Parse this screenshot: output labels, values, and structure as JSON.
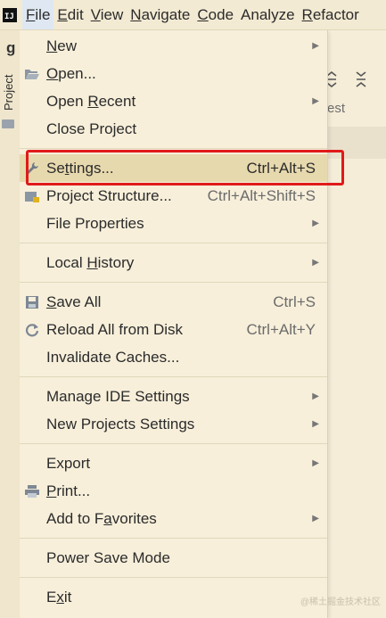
{
  "menubar": {
    "app_icon_text": "IJ",
    "menus": [
      {
        "label": "File",
        "mnemonic": "F",
        "rest": "ile"
      },
      {
        "label": "Edit",
        "mnemonic": "E",
        "rest": "dit"
      },
      {
        "label": "View",
        "mnemonic": "V",
        "rest": "iew"
      },
      {
        "label": "Navigate",
        "mnemonic": "N",
        "rest": "avigate"
      },
      {
        "label": "Code",
        "mnemonic": "C",
        "rest": "ode"
      },
      {
        "label": "Analyze",
        "mnemonic": "",
        "rest": "Analyze"
      },
      {
        "label": "Refactor",
        "mnemonic": "R",
        "rest": "efactor"
      }
    ]
  },
  "background": {
    "project_letter": "g",
    "project_tab": "Project",
    "right_text": "est"
  },
  "file_menu": {
    "items": [
      {
        "label_pre": "",
        "mn": "N",
        "label_post": "ew",
        "shortcut": "",
        "submenu": true,
        "icon": ""
      },
      {
        "label_pre": "",
        "mn": "O",
        "label_post": "pen...",
        "shortcut": "",
        "submenu": false,
        "icon": "folder-open-icon"
      },
      {
        "label_pre": "Open ",
        "mn": "R",
        "label_post": "ecent",
        "shortcut": "",
        "submenu": true,
        "icon": ""
      },
      {
        "label_pre": "Close Project",
        "mn": "",
        "label_post": "",
        "shortcut": "",
        "submenu": false,
        "icon": ""
      },
      {
        "label_pre": "Se",
        "mn": "t",
        "label_post": "tings...",
        "shortcut": "Ctrl+Alt+S",
        "submenu": false,
        "icon": "wrench-icon"
      },
      {
        "label_pre": "Project Structure...",
        "mn": "",
        "label_post": "",
        "shortcut": "Ctrl+Alt+Shift+S",
        "submenu": false,
        "icon": "project-structure-icon"
      },
      {
        "label_pre": "File Properties",
        "mn": "",
        "label_post": "",
        "shortcut": "",
        "submenu": true,
        "icon": ""
      },
      {
        "label_pre": "Local ",
        "mn": "H",
        "label_post": "istory",
        "shortcut": "",
        "submenu": true,
        "icon": ""
      },
      {
        "label_pre": "",
        "mn": "S",
        "label_post": "ave All",
        "shortcut": "Ctrl+S",
        "submenu": false,
        "icon": "save-icon"
      },
      {
        "label_pre": "Reload All from Disk",
        "mn": "",
        "label_post": "",
        "shortcut": "Ctrl+Alt+Y",
        "submenu": false,
        "icon": "reload-icon"
      },
      {
        "label_pre": "Invalidate Caches...",
        "mn": "",
        "label_post": "",
        "shortcut": "",
        "submenu": false,
        "icon": ""
      },
      {
        "label_pre": "Manage IDE Settings",
        "mn": "",
        "label_post": "",
        "shortcut": "",
        "submenu": true,
        "icon": ""
      },
      {
        "label_pre": "New Projects Settings",
        "mn": "",
        "label_post": "",
        "shortcut": "",
        "submenu": true,
        "icon": ""
      },
      {
        "label_pre": "Export",
        "mn": "",
        "label_post": "",
        "shortcut": "",
        "submenu": true,
        "icon": ""
      },
      {
        "label_pre": "",
        "mn": "P",
        "label_post": "rint...",
        "shortcut": "",
        "submenu": false,
        "icon": "print-icon"
      },
      {
        "label_pre": "Add to F",
        "mn": "a",
        "label_post": "vorites",
        "shortcut": "",
        "submenu": true,
        "icon": ""
      },
      {
        "label_pre": "Power Save Mode",
        "mn": "",
        "label_post": "",
        "shortcut": "",
        "submenu": false,
        "icon": ""
      },
      {
        "label_pre": "E",
        "mn": "x",
        "label_post": "it",
        "shortcut": "",
        "submenu": false,
        "icon": ""
      }
    ]
  },
  "highlight_color": "#e01a1a",
  "watermark": "@稀土掘金技术社区"
}
